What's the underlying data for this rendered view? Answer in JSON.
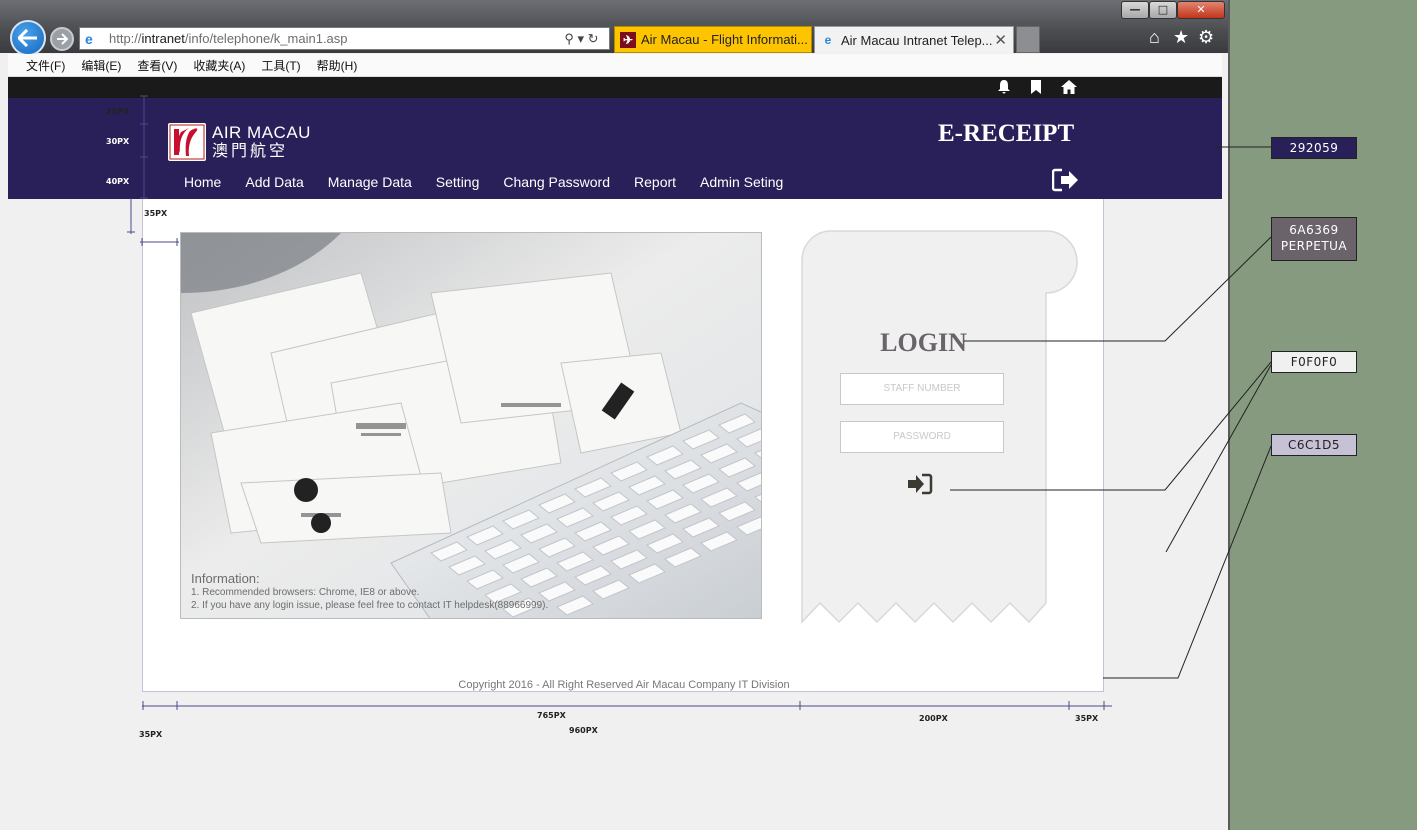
{
  "browser": {
    "address_url_prefix": "http://",
    "address_url_host": "intranet",
    "address_url_path": "/info/telephone/k_main1.asp",
    "address_tools": "⚲ ▾ ↻",
    "tabs": [
      {
        "label": "Air Macau - Flight Informati...",
        "active": false
      },
      {
        "label": "Air Macau Intranet Telep...",
        "active": true
      }
    ],
    "window_controls": {
      "minimize": "—",
      "maximize": "□",
      "close": "✕"
    },
    "menu": [
      "文件(F)",
      "编辑(E)",
      "查看(V)",
      "收藏夹(A)",
      "工具(T)",
      "帮助(H)"
    ]
  },
  "site": {
    "logo_en": "AIR MACAU",
    "logo_zh": "澳門航空",
    "title": "E-RECEIPT",
    "nav": [
      "Home",
      "Add Data",
      "Manage Data",
      "Setting",
      "Chang Password",
      "Report",
      "Admin Seting"
    ],
    "topstrip_icons": [
      "bell-icon",
      "bookmark-icon",
      "home-icon"
    ],
    "info": {
      "heading": "Information:",
      "line1": "1. Recommended browsers:  Chrome, IE8 or above.",
      "line2": "2. If you have any login issue, please feel free to contact IT helpdesk(88966999)."
    },
    "login": {
      "title": "LOGIN",
      "staff_placeholder": "STAFF NUMBER",
      "password_placeholder": "PASSWORD"
    },
    "copyright": "Copyright  2016 - All Right Reserved Air Macau Company IT Division"
  },
  "annotations": {
    "header_dims": [
      "25PX",
      "30PX",
      "40PX"
    ],
    "gap_top": "35PX",
    "gap_left": "35PX",
    "width_image": "765PX",
    "width_total": "960PX",
    "width_login": "200PX",
    "width_right": "35PX",
    "swatches": [
      {
        "label": "292059",
        "color": "#292059"
      },
      {
        "label": "6A6369\nPERPETUA",
        "color": "#6a6369"
      },
      {
        "label": "F0F0F0",
        "color": "#f0f0f0"
      },
      {
        "label": "C6C1D5",
        "color": "#c6c1d5"
      }
    ]
  }
}
